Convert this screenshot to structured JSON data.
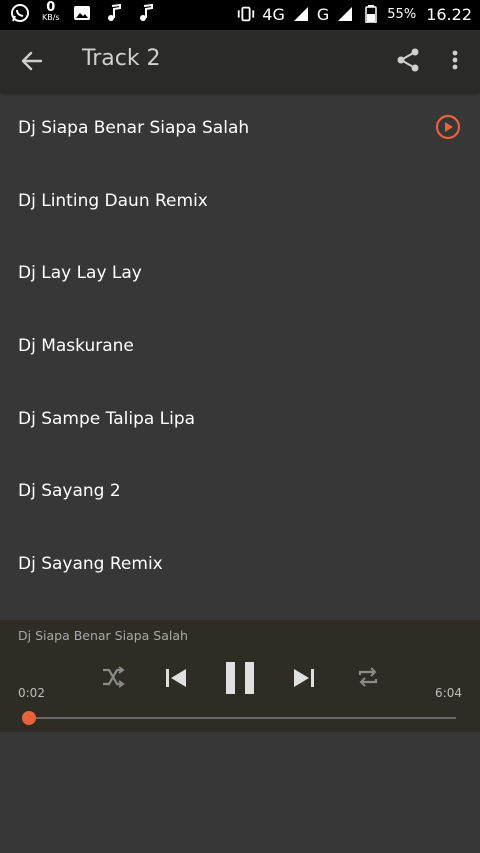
{
  "status_bar": {
    "data_rate_value": "0",
    "data_rate_unit": "KB/s",
    "network_4g": "4G",
    "network_g": "G",
    "battery": "55%",
    "time": "16.22"
  },
  "app_bar": {
    "title": "Track 2",
    "back_icon": "arrow-left-icon",
    "share_icon": "share-icon",
    "more_icon": "more-vert-icon"
  },
  "tracks": [
    {
      "title": "Dj Siapa Benar Siapa Salah",
      "playing": true
    },
    {
      "title": "Dj Linting Daun Remix",
      "playing": false
    },
    {
      "title": "Dj Lay Lay Lay",
      "playing": false
    },
    {
      "title": "Dj Maskurane",
      "playing": false
    },
    {
      "title": "Dj Sampe Talipa Lipa",
      "playing": false
    },
    {
      "title": "Dj Sayang 2",
      "playing": false
    },
    {
      "title": "Dj Sayang Remix",
      "playing": false
    }
  ],
  "player": {
    "now_playing": "Dj Siapa Benar Siapa Salah",
    "current_time": "0:02",
    "total_time": "6:04",
    "progress_fraction": 0.0055
  },
  "colors": {
    "accent": "#e8623a",
    "background": "#373737",
    "app_bar": "#2a2a28",
    "player": "#2e2c24"
  }
}
